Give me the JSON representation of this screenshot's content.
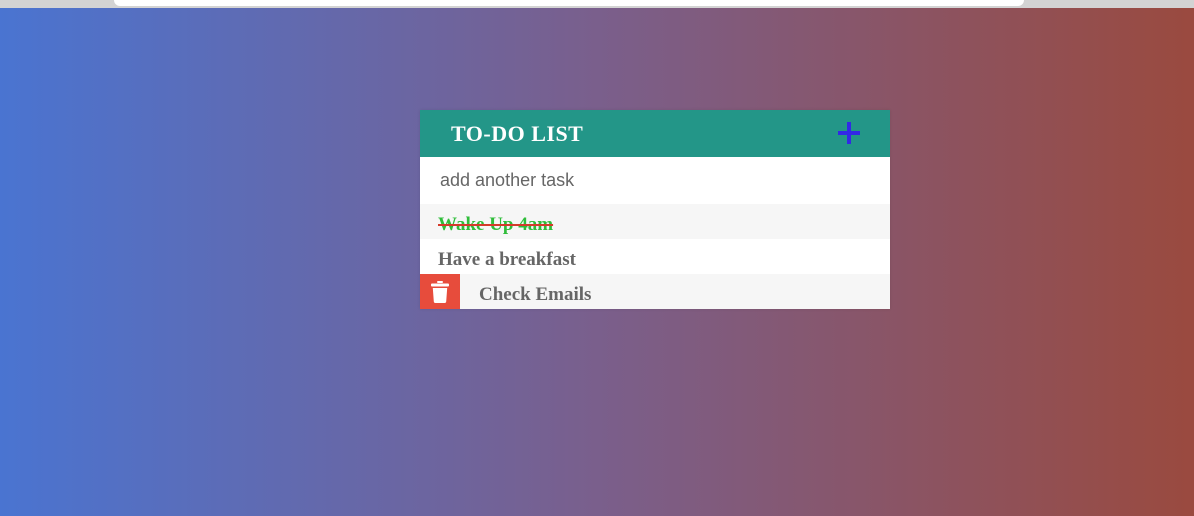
{
  "colors": {
    "header_bg": "#239688",
    "add_icon": "#3228e6",
    "completed_text": "#2fbd3a",
    "strike": "#d43a2a",
    "delete_bg": "#e74c3c",
    "bg_left": "#4a74d1",
    "bg_right": "#9a4a3f"
  },
  "todo": {
    "title": "TO-DO LIST",
    "add_icon": "plus-icon",
    "input": {
      "value": "",
      "placeholder": "add another task"
    },
    "items": [
      {
        "text": "Wake Up 4am",
        "completed": true
      },
      {
        "text": "Have a breakfast",
        "completed": false
      },
      {
        "text": "Check Emails",
        "completed": false,
        "delete_icon": "trash-icon"
      }
    ]
  }
}
